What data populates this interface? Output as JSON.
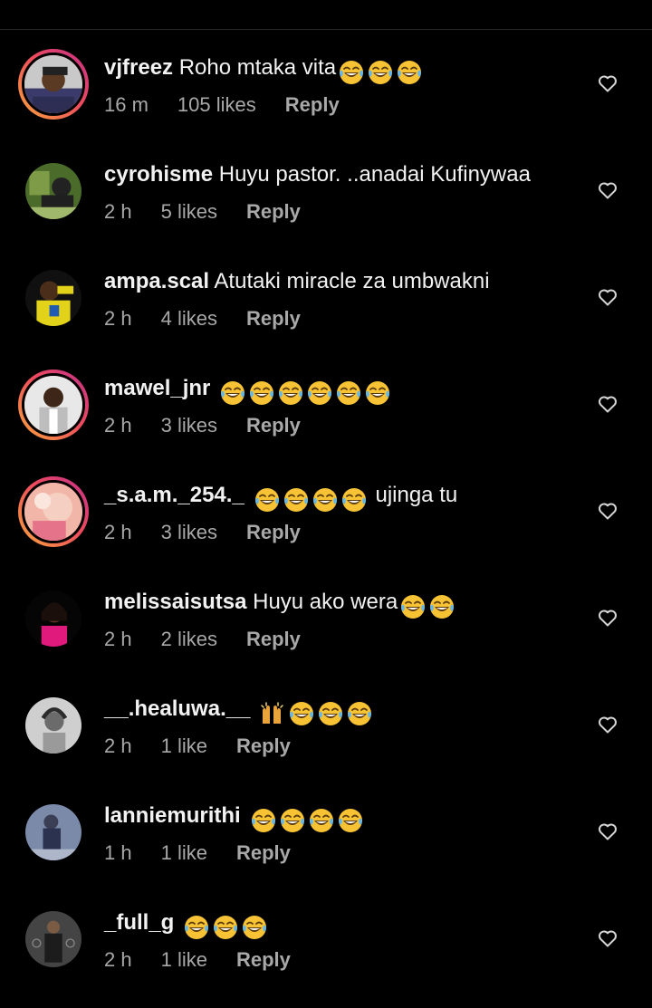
{
  "comments": [
    {
      "username": "vjfreez",
      "text": "Roho mtaka vita",
      "emojis": [
        "joy",
        "joy",
        "joy"
      ],
      "emojis_after": [],
      "trailing": "",
      "time": "16 m",
      "likes": "105 likes",
      "reply": "Reply",
      "story_ring": true
    },
    {
      "username": "cyrohisme",
      "text": "Huyu pastor. ..anadai Kufinywaa",
      "emojis": [],
      "emojis_after": [],
      "trailing": "",
      "time": "2 h",
      "likes": "5 likes",
      "reply": "Reply",
      "story_ring": false
    },
    {
      "username": "ampa.scal",
      "text": "Atutaki miracle za umbwakni",
      "emojis": [],
      "emojis_after": [],
      "trailing": "",
      "time": "2 h",
      "likes": "4 likes",
      "reply": "Reply",
      "story_ring": false
    },
    {
      "username": "mawel_jnr",
      "text": "",
      "emojis": [
        "joy",
        "joy",
        "joy",
        "joy",
        "joy",
        "joy"
      ],
      "emojis_after": [],
      "trailing": "",
      "time": "2 h",
      "likes": "3 likes",
      "reply": "Reply",
      "story_ring": true
    },
    {
      "username": "_s.a.m._254._",
      "text": "",
      "emojis": [
        "joy",
        "joy",
        "joy",
        "joy"
      ],
      "emojis_after": [],
      "trailing": "ujinga tu",
      "time": "2 h",
      "likes": "3 likes",
      "reply": "Reply",
      "story_ring": true
    },
    {
      "username": "melissaisutsa",
      "text": "Huyu ako wera",
      "emojis": [
        "joy",
        "joy"
      ],
      "emojis_after": [],
      "trailing": "",
      "time": "2 h",
      "likes": "2 likes",
      "reply": "Reply",
      "story_ring": false
    },
    {
      "username": "__.healuwa.__",
      "text": "",
      "emojis": [
        "raised-hands",
        "joy",
        "joy",
        "joy"
      ],
      "emojis_after": [],
      "trailing": "",
      "time": "2 h",
      "likes": "1 like",
      "reply": "Reply",
      "story_ring": false
    },
    {
      "username": "lanniemurithi",
      "text": "",
      "emojis": [
        "joy",
        "joy",
        "joy",
        "joy"
      ],
      "emojis_after": [],
      "trailing": "",
      "time": "1 h",
      "likes": "1 like",
      "reply": "Reply",
      "story_ring": false
    },
    {
      "username": "_full_g",
      "text": "",
      "emojis": [
        "joy",
        "joy",
        "joy"
      ],
      "emojis_after": [],
      "trailing": "",
      "time": "2 h",
      "likes": "1 like",
      "reply": "Reply",
      "story_ring": false
    }
  ],
  "icons": {
    "like": "heart-outline-icon",
    "emoji_joy": "face-with-tears-of-joy-icon",
    "emoji_hands": "raising-hands-icon"
  },
  "colors": {
    "background": "#000000",
    "text": "#f2f2f2",
    "secondary": "#a8a8a8",
    "ring_start": "#f9a73c",
    "ring_end": "#c22f8a"
  }
}
